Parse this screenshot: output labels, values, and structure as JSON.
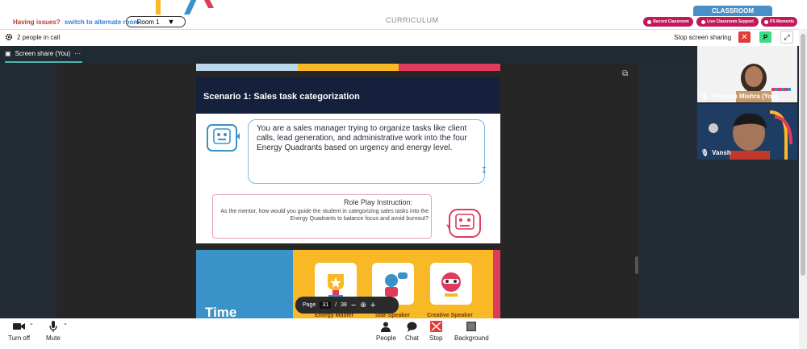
{
  "header": {
    "issues_text": "Having issues?",
    "alternate_link": "switch to alternate room",
    "room_label": "Room 1",
    "curriculum_label": "CURRICULUM",
    "classroom_label": "CLASSROOM",
    "buttons": [
      "Record Classroom",
      "Live Classroom Support",
      "PS Moments"
    ]
  },
  "call_bar": {
    "people_in_call": "2 people in call",
    "stop_sharing_label": "Stop screen sharing",
    "participant_initial": "P"
  },
  "share": {
    "tab_label": "Screen share (You)",
    "more_label": "···"
  },
  "slide": {
    "title": "Scenario 1: Sales task categorization",
    "scenario_text": "You are a sales manager trying to organize tasks like client calls, lead generation, and administrative work into the four Energy Quadrants based on urgency and energy level.",
    "roleplay_title": "Role Play Instruction:",
    "roleplay_text": "As the mentor, how would you guide the student in categorizing sales tasks into the Energy Quadrants to balance focus and avoid burnout?",
    "stripe_colors": [
      "#bcd6ea",
      "#f9b825",
      "#e03a5c"
    ]
  },
  "slide2": {
    "heading": "Time",
    "awards": [
      "Energy Master",
      "Star Speaker",
      "Creative Speaker"
    ]
  },
  "pager": {
    "page_label": "Page",
    "current_page": "31",
    "separator": "/",
    "total_pages": "38"
  },
  "participants": [
    {
      "name": "Poonam Mishra (You)"
    },
    {
      "name": "Vansh"
    }
  ],
  "controls": {
    "camera": "Turn off",
    "mic": "Mute",
    "people": "People",
    "chat": "Chat",
    "stop": "Stop",
    "background": "Background"
  },
  "colors": {
    "accent_pink": "#c2185b",
    "classroom_blue": "#4a90c8",
    "stop_red": "#e53935",
    "participant_green": "#3ddc84"
  }
}
